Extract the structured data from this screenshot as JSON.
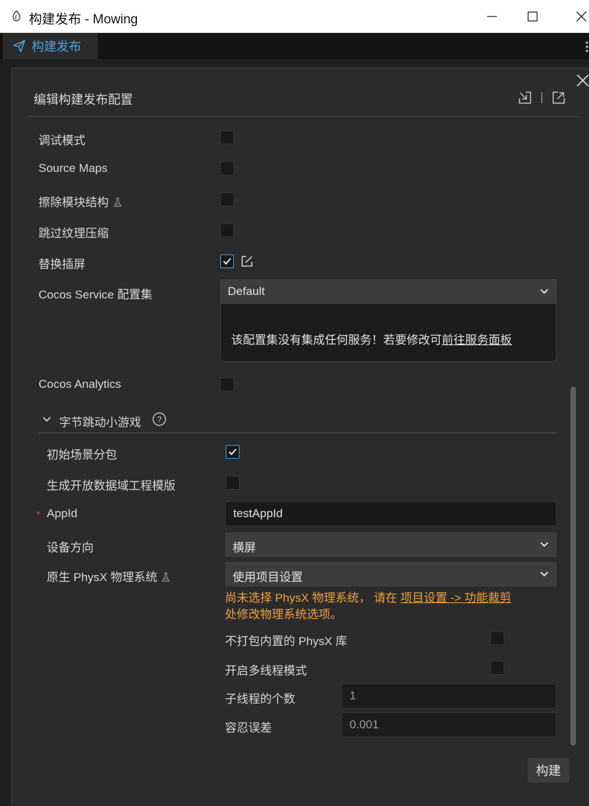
{
  "window": {
    "title": "构建发布 - Mowing"
  },
  "tab": {
    "label": "构建发布"
  },
  "panel": {
    "title": "编辑构建发布配置"
  },
  "options": {
    "debug_mode": {
      "label": "调试模式",
      "checked": false
    },
    "source_maps": {
      "label": "Source Maps",
      "checked": false
    },
    "erase_module": {
      "label": "擦除模块结构",
      "checked": false
    },
    "skip_compress": {
      "label": "跳过纹理压缩",
      "checked": false
    },
    "replace_splash": {
      "label": "替换插屏",
      "checked": true
    },
    "cocos_service": {
      "label": "Cocos Service 配置集",
      "value": "Default"
    },
    "service_info": {
      "text": "该配置集没有集成任何服务！若要修改可",
      "link": "前往服务面板"
    },
    "cocos_analytics": {
      "label": "Cocos Analytics",
      "checked": false
    }
  },
  "section": {
    "title": "字节跳动小游戏",
    "help": "?",
    "initial_scene_subpackage": {
      "label": "初始场景分包",
      "checked": true
    },
    "open_data_template": {
      "label": "生成开放数据域工程模版",
      "checked": false
    },
    "appid": {
      "label": "AppId",
      "required": "*",
      "value": "testAppId"
    },
    "orientation": {
      "label": "设备方向",
      "value": "横屏"
    },
    "physx": {
      "label": "原生 PhysX 物理系统",
      "value": "使用项目设置"
    },
    "physx_warning": {
      "line1_prefix": "尚未选择 PhysX 物理系统， 请在 ",
      "line1_link": "项目设置 -> 功能裁剪",
      "line2": "处修改物理系统选项。"
    },
    "no_builtin_physx": {
      "label": "不打包内置的 PhysX 库",
      "checked": false
    },
    "multithread": {
      "label": "开启多线程模式",
      "checked": false
    },
    "subthread_count": {
      "label": "子线程的个数",
      "value": "1"
    },
    "tolerance": {
      "label": "容忍误差",
      "value": "0.001"
    }
  },
  "actions": {
    "build": "构建"
  },
  "colors": {
    "accent": "#4aa3df",
    "warning": "#f0a040",
    "required": "#d54b4b",
    "panel_bg": "#2b2b2b"
  }
}
